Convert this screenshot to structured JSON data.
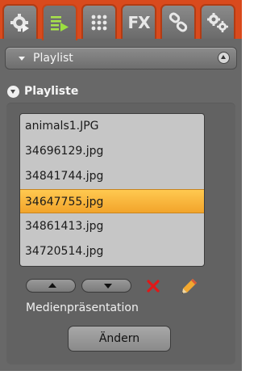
{
  "tabs": [
    {
      "icon": "gear-play-icon"
    },
    {
      "icon": "playlist-icon"
    },
    {
      "icon": "grid-icon"
    },
    {
      "icon": "fx-icon",
      "label": "FX"
    },
    {
      "icon": "link-icon"
    },
    {
      "icon": "gears-icon"
    }
  ],
  "section": {
    "title": "Playlist"
  },
  "subhead": {
    "title": "Playliste"
  },
  "playlist": {
    "items": [
      "animals1.JPG",
      "34696129.jpg",
      "34841744.jpg",
      "34647755.jpg",
      "34861413.jpg",
      "34720514.jpg"
    ],
    "selected_index": 3
  },
  "controls": {
    "move_up_icon": "arrow-up-icon",
    "move_down_icon": "arrow-down-icon",
    "delete_icon": "red-x-icon",
    "edit_icon": "pencil-icon"
  },
  "presentation": {
    "caption": "Medienpräsentation",
    "button_label": "Ändern"
  },
  "colors": {
    "accent": "#d94a1d",
    "selection": "#f7b53c",
    "panel": "#686868"
  }
}
